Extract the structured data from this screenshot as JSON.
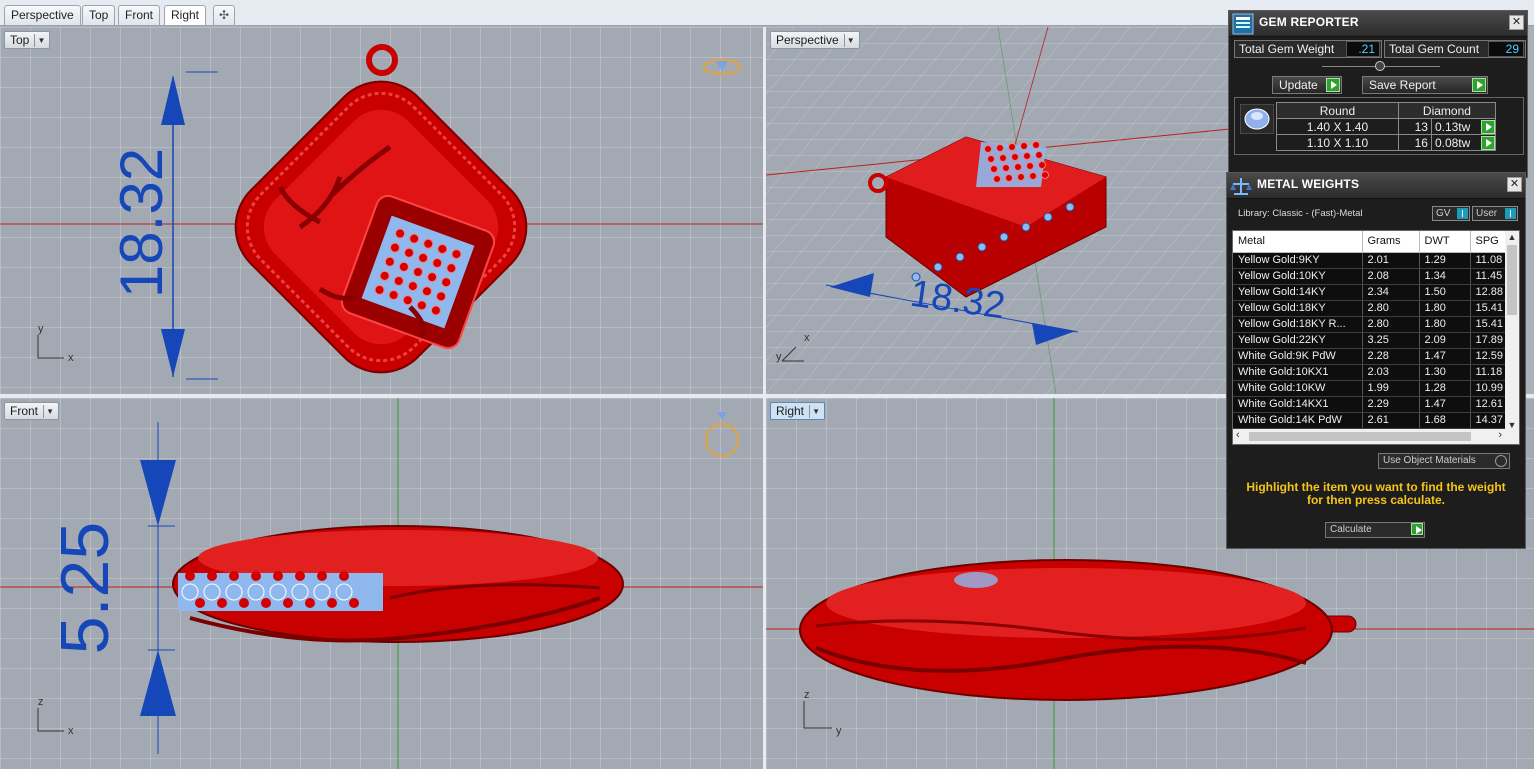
{
  "tabs": [
    {
      "label": "Perspective",
      "active": false
    },
    {
      "label": "Top",
      "active": false
    },
    {
      "label": "Front",
      "active": false
    },
    {
      "label": "Right",
      "active": true
    }
  ],
  "viewports": {
    "top": {
      "label": "Top",
      "dimension": "18.32",
      "axis_v": "y",
      "axis_h": "x"
    },
    "perspective": {
      "label": "Perspective",
      "dimension": "18.32",
      "axis_v": "y",
      "axis_h": "x"
    },
    "front": {
      "label": "Front",
      "dimension": "5.25",
      "axis_v": "z",
      "axis_h": "x"
    },
    "right": {
      "label": "Right",
      "axis_v": "z",
      "axis_h": "y"
    }
  },
  "gem_reporter": {
    "title": "GEM REPORTER",
    "close": "✕",
    "total_weight_label": "Total Gem Weight",
    "total_weight_value": ".21",
    "total_count_label": "Total Gem Count",
    "total_count_value": "29",
    "update_label": "Update",
    "save_report_label": "Save Report",
    "gem_header": {
      "shape": "Round",
      "type": "Diamond"
    },
    "gem_rows": [
      {
        "size": "1.40 X 1.40",
        "count": "13",
        "weight": "0.13tw"
      },
      {
        "size": "1.10 X 1.10",
        "count": "16",
        "weight": "0.08tw"
      }
    ]
  },
  "metal_weights": {
    "title": "METAL WEIGHTS",
    "close": "✕",
    "library_label": "Library: Classic - (Fast)-Metal",
    "gv_label": "GV",
    "user_label": "User",
    "columns": [
      "Metal",
      "Grams",
      "DWT",
      "SPG"
    ],
    "rows": [
      {
        "metal": "Yellow Gold:9KY",
        "grams": "2.01",
        "dwt": "1.29",
        "spg": "11.08"
      },
      {
        "metal": "Yellow Gold:10KY",
        "grams": "2.08",
        "dwt": "1.34",
        "spg": "11.45"
      },
      {
        "metal": "Yellow Gold:14KY",
        "grams": "2.34",
        "dwt": "1.50",
        "spg": "12.88"
      },
      {
        "metal": "Yellow Gold:18KY",
        "grams": "2.80",
        "dwt": "1.80",
        "spg": "15.41"
      },
      {
        "metal": "Yellow Gold:18KY R...",
        "grams": "2.80",
        "dwt": "1.80",
        "spg": "15.41"
      },
      {
        "metal": "Yellow Gold:22KY",
        "grams": "3.25",
        "dwt": "2.09",
        "spg": "17.89"
      },
      {
        "metal": "White Gold:9K PdW",
        "grams": "2.28",
        "dwt": "1.47",
        "spg": "12.59"
      },
      {
        "metal": "White Gold:10KX1",
        "grams": "2.03",
        "dwt": "1.30",
        "spg": "11.18"
      },
      {
        "metal": "White Gold:10KW",
        "grams": "1.99",
        "dwt": "1.28",
        "spg": "10.99"
      },
      {
        "metal": "White Gold:14KX1",
        "grams": "2.29",
        "dwt": "1.47",
        "spg": "12.61"
      },
      {
        "metal": "White Gold:14K PdW",
        "grams": "2.61",
        "dwt": "1.68",
        "spg": "14.37"
      }
    ],
    "use_object_materials": "Use Object Materials",
    "instruction": "Highlight the item you want to find the weight for then press calculate.",
    "calculate_label": "Calculate"
  },
  "colors": {
    "model_red": "#d20000",
    "gem_blue": "#8fb8ee",
    "dimension_blue": "#1547b8",
    "instruction_yellow": "#f5c518"
  }
}
